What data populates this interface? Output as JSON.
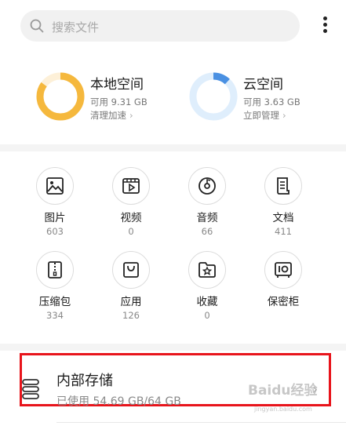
{
  "search": {
    "placeholder": "搜索文件",
    "icon": "search-icon"
  },
  "menu": {
    "icon": "more-vertical-icon"
  },
  "storage": {
    "local": {
      "title": "本地空间",
      "available": "可用 9.31 GB",
      "action": "清理加速",
      "used_fraction": 0.85,
      "color": "#f5b83d",
      "track": "#fdf0d8"
    },
    "cloud": {
      "title": "云空间",
      "available": "可用 3.63 GB",
      "action": "立即管理",
      "used_fraction": 0.12,
      "color": "#4a90e2",
      "track": "#dfeefc"
    }
  },
  "categories": [
    {
      "name": "图片",
      "count": "603",
      "icon": "image-icon"
    },
    {
      "name": "视频",
      "count": "0",
      "icon": "video-icon"
    },
    {
      "name": "音频",
      "count": "66",
      "icon": "music-disc-icon"
    },
    {
      "name": "文档",
      "count": "411",
      "icon": "document-icon"
    },
    {
      "name": "压缩包",
      "count": "334",
      "icon": "zip-icon"
    },
    {
      "name": "应用",
      "count": "126",
      "icon": "app-bag-icon"
    },
    {
      "name": "收藏",
      "count": "0",
      "icon": "star-folder-icon"
    },
    {
      "name": "保密柜",
      "count": "",
      "icon": "safe-icon"
    }
  ],
  "internal": {
    "title": "内部存储",
    "usage": "已使用 54.69 GB/64 GB",
    "icon": "storage-icon",
    "chevron": "›"
  },
  "colors": {
    "highlight": "#e8141b",
    "text": "#1a1a1a",
    "muted": "#888888"
  },
  "watermark": {
    "text": "Baidu经验",
    "sub": "jingyan.baidu.com"
  }
}
